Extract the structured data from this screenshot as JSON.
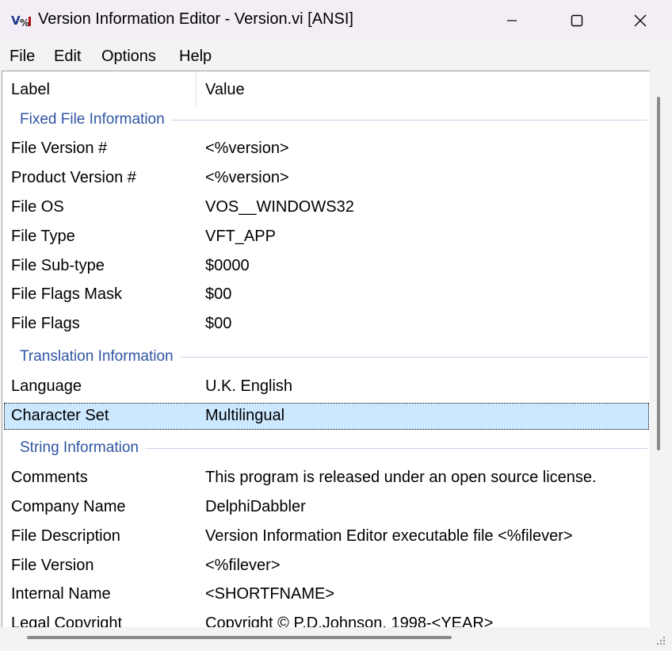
{
  "window": {
    "title": "Version Information Editor - Version.vi [ANSI]",
    "icons": {
      "app": "version-editor-app-icon",
      "minimize": "minimize-icon",
      "maximize": "maximize-icon",
      "close": "close-icon"
    }
  },
  "menu": {
    "items": [
      "File",
      "Edit",
      "Options",
      "Help"
    ]
  },
  "table": {
    "columns": {
      "label": "Label",
      "value": "Value"
    },
    "groups": [
      {
        "title": "Fixed File Information",
        "rows": [
          {
            "label": "File Version #",
            "value": "<%version>"
          },
          {
            "label": "Product Version #",
            "value": "<%version>"
          },
          {
            "label": "File OS",
            "value": "VOS__WINDOWS32"
          },
          {
            "label": "File Type",
            "value": "VFT_APP"
          },
          {
            "label": "File Sub-type",
            "value": "$0000"
          },
          {
            "label": "File Flags Mask",
            "value": "$00"
          },
          {
            "label": "File Flags",
            "value": "$00"
          }
        ]
      },
      {
        "title": "Translation Information",
        "rows": [
          {
            "label": "Language",
            "value": "U.K. English"
          },
          {
            "label": "Character Set",
            "value": "Multilingual",
            "selected": true
          }
        ]
      },
      {
        "title": "String Information",
        "rows": [
          {
            "label": "Comments",
            "value": "This program is released under an open source license."
          },
          {
            "label": "Company Name",
            "value": "DelphiDabbler"
          },
          {
            "label": "File Description",
            "value": "Version Information Editor executable file <%filever>"
          },
          {
            "label": "File Version",
            "value": "<%filever>"
          },
          {
            "label": "Internal Name",
            "value": "<SHORTFNAME>"
          },
          {
            "label": "Legal Copyright",
            "value": "Copyright © P.D.Johnson, 1998-<YEAR>"
          }
        ]
      }
    ]
  },
  "colors": {
    "group_title": "#2f55a4",
    "selection": "#cce8ff",
    "titlebar": "#f3eef6"
  }
}
